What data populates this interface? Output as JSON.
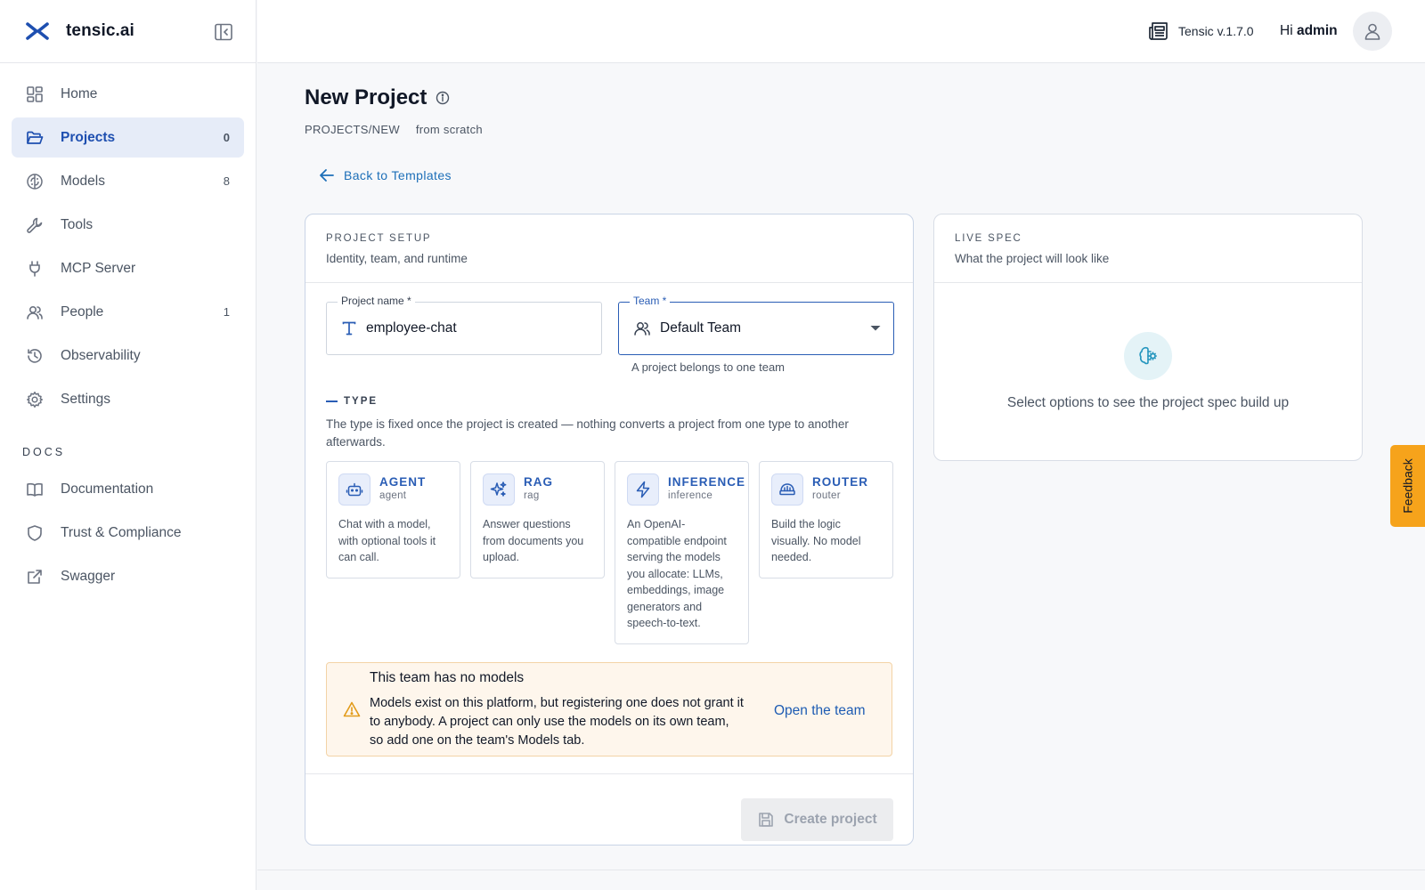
{
  "brand": {
    "name": "tensic.ai"
  },
  "sidebar": {
    "items": [
      {
        "label": "Home",
        "count": ""
      },
      {
        "label": "Projects",
        "count": "0"
      },
      {
        "label": "Models",
        "count": "8"
      },
      {
        "label": "Tools",
        "count": ""
      },
      {
        "label": "MCP Server",
        "count": ""
      },
      {
        "label": "People",
        "count": "1"
      },
      {
        "label": "Observability",
        "count": ""
      },
      {
        "label": "Settings",
        "count": ""
      }
    ],
    "docs_label": "DOCS",
    "docs_items": [
      {
        "label": "Documentation"
      },
      {
        "label": "Trust & Compliance"
      },
      {
        "label": "Swagger"
      }
    ]
  },
  "header": {
    "version": "Tensic v.1.7.0",
    "greeting": "Hi",
    "user": "admin"
  },
  "page": {
    "title": "New Project",
    "crumb_path": "PROJECTS/NEW",
    "crumb_mode": "from scratch",
    "back_label": "Back to Templates"
  },
  "setup": {
    "kicker": "PROJECT SETUP",
    "subtitle": "Identity, team, and runtime",
    "project_name_label": "Project name *",
    "project_name_value": "employee-chat",
    "team_label": "Team *",
    "team_value": "Default Team",
    "team_helper": "A project belongs to one team",
    "type_heading": "TYPE",
    "type_description": "The type is fixed once the project is created — nothing converts a project from one type to another afterwards.",
    "types": [
      {
        "name": "AGENT",
        "slug": "agent",
        "desc": "Chat with a model, with optional tools it can call."
      },
      {
        "name": "RAG",
        "slug": "rag",
        "desc": "Answer questions from documents you upload."
      },
      {
        "name": "INFERENCE",
        "slug": "inference",
        "desc": "An OpenAI-compatible endpoint serving the models you allocate: LLMs, embeddings, image generators and speech-to-text."
      },
      {
        "name": "ROUTER",
        "slug": "router",
        "desc": "Build the logic visually. No model needed."
      }
    ],
    "alert": {
      "title": "This team has no models",
      "body": "Models exist on this platform, but registering one does not grant it to anybody. A project can only use the models on its own team, so add one on the team's Models tab.",
      "link": "Open the team"
    },
    "create_label": "Create project"
  },
  "spec": {
    "kicker": "LIVE SPEC",
    "subtitle": "What the project will look like",
    "empty_message": "Select options to see the project spec build up"
  },
  "feedback": {
    "label": "Feedback"
  }
}
